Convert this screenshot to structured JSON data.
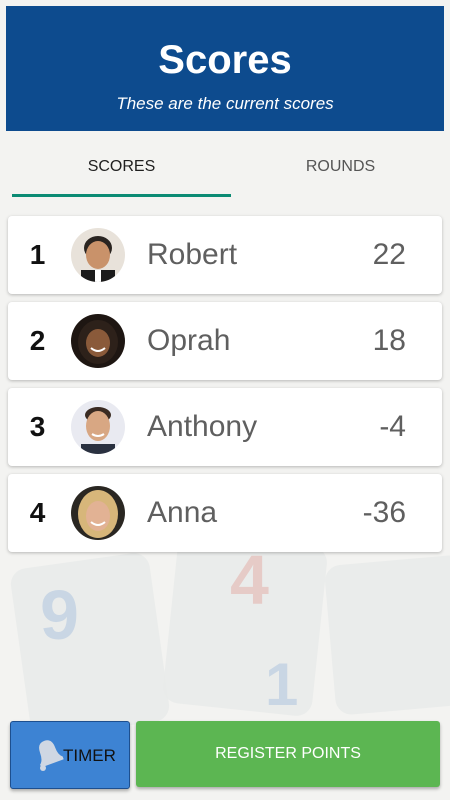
{
  "header": {
    "title": "Scores",
    "subtitle": "These are the current scores",
    "background_color": "#0d4b8e"
  },
  "tabs": [
    {
      "label": "SCORES",
      "active": true
    },
    {
      "label": "ROUNDS",
      "active": false
    }
  ],
  "players": [
    {
      "rank": "1",
      "name": "Robert",
      "score": "22",
      "avatar": "robert-avatar"
    },
    {
      "rank": "2",
      "name": "Oprah",
      "score": "18",
      "avatar": "oprah-avatar"
    },
    {
      "rank": "3",
      "name": "Anthony",
      "score": "-4",
      "avatar": "anthony-avatar"
    },
    {
      "rank": "4",
      "name": "Anna",
      "score": "-36",
      "avatar": "anna-avatar"
    }
  ],
  "footer": {
    "timer_label": "TIMER",
    "timer_icon": "bell-icon",
    "register_label": "REGISTER POINTS",
    "timer_color": "#3d83d3",
    "register_color": "#5cb652"
  }
}
